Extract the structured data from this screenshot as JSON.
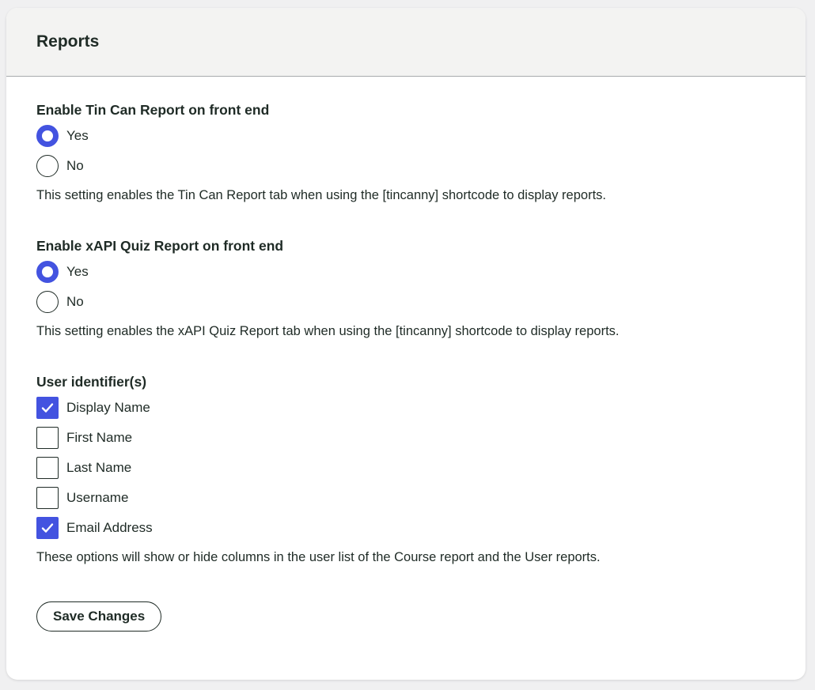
{
  "header": {
    "title": "Reports"
  },
  "tincan_report": {
    "title": "Enable Tin Can Report on front end",
    "options": [
      {
        "label": "Yes",
        "checked": true
      },
      {
        "label": "No",
        "checked": false
      }
    ],
    "description": "This setting enables the Tin Can Report tab when using the [tincanny] shortcode to display reports."
  },
  "xapi_report": {
    "title": "Enable xAPI Quiz Report on front end",
    "options": [
      {
        "label": "Yes",
        "checked": true
      },
      {
        "label": "No",
        "checked": false
      }
    ],
    "description": "This setting enables the xAPI Quiz Report tab when using the [tincanny] shortcode to display reports."
  },
  "user_identifiers": {
    "title": "User identifier(s)",
    "options": [
      {
        "label": "Display Name",
        "checked": true
      },
      {
        "label": "First Name",
        "checked": false
      },
      {
        "label": "Last Name",
        "checked": false
      },
      {
        "label": "Username",
        "checked": false
      },
      {
        "label": "Email Address",
        "checked": true
      }
    ],
    "description": "These options will show or hide columns in the user list of the Course report and the User reports."
  },
  "actions": {
    "save_label": "Save Changes"
  },
  "colors": {
    "accent": "#4353e0",
    "text": "#1f2b26",
    "header_bg": "#f3f3f2"
  }
}
